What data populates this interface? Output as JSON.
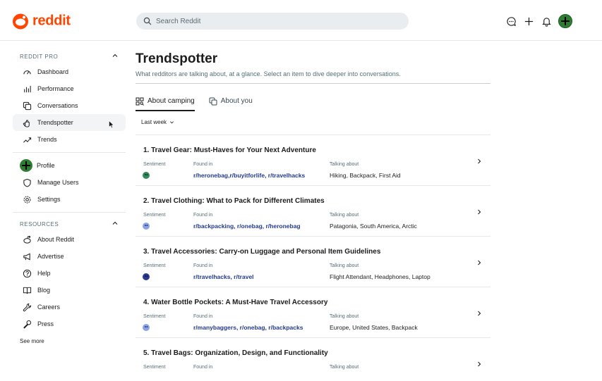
{
  "header": {
    "logo_text": "reddit",
    "search_placeholder": "Search Reddit",
    "icons": [
      "chat-icon",
      "plus-icon",
      "bell-icon",
      "avatar"
    ]
  },
  "sidebar": {
    "pro_section": "REDDIT PRO",
    "pro_items": [
      {
        "label": "Dashboard",
        "icon": "gauge-icon"
      },
      {
        "label": "Performance",
        "icon": "bar-chart-icon"
      },
      {
        "label": "Conversations",
        "icon": "conversations-icon"
      },
      {
        "label": "Trendspotter",
        "icon": "hand-icon"
      },
      {
        "label": "Trends",
        "icon": "trend-icon"
      }
    ],
    "account_items": [
      {
        "label": "Profile",
        "icon": "avatar"
      },
      {
        "label": "Manage Users",
        "icon": "shield-icon"
      },
      {
        "label": "Settings",
        "icon": "gear-icon"
      }
    ],
    "resources_section": "RESOURCES",
    "resource_items": [
      {
        "label": "About Reddit",
        "icon": "reddit-icon"
      },
      {
        "label": "Advertise",
        "icon": "megaphone-icon"
      },
      {
        "label": "Help",
        "icon": "help-icon"
      },
      {
        "label": "Blog",
        "icon": "book-icon"
      },
      {
        "label": "Careers",
        "icon": "wrench-icon"
      },
      {
        "label": "Press",
        "icon": "mic-icon"
      }
    ],
    "see_more": "See more"
  },
  "main": {
    "title": "Trendspotter",
    "subtitle": "What redditors are talking about, at a glance. Select an item to dive deeper into conversations.",
    "tabs": [
      {
        "label": "About camping",
        "active": true
      },
      {
        "label": "About you",
        "active": false
      }
    ],
    "filter": "Last week",
    "col_sentiment": "Sentiment",
    "col_found": "Found in",
    "col_talking": "Talking about",
    "trends": [
      {
        "title": "1. Travel Gear: Must-Haves for Your Next Adventure",
        "sentiment_color": "#2e8b57",
        "found_in": "r/heronebag,r/buyitforlife, r/travelhacks",
        "talking_about": "Hiking, Backpack, First Aid"
      },
      {
        "title": "2. Travel Clothing: What to Pack for Different Climates",
        "sentiment_color": "#8aa3e8",
        "found_in": "r/backpacking, r/onebag, r/heronebag",
        "talking_about": "Patagonia, South America, Arctic"
      },
      {
        "title": "3. Travel Accessories: Carry-on Luggage and Personal Item Guidelines",
        "sentiment_color": "#2b3a8f",
        "found_in": "r/travelhacks, r/travel",
        "talking_about": "Flight Attendant, Headphones, Laptop"
      },
      {
        "title": "4. Water Bottle Pockets: A Must-Have Travel Accessory",
        "sentiment_color": "#8aa3e8",
        "found_in": "r/manybaggers, r/onebag, r/backpacks",
        "talking_about": "Europe, United States, Backpack"
      },
      {
        "title": "5. Travel Bags: Organization, Design, and Functionality",
        "sentiment_color": "",
        "found_in": "",
        "talking_about": ""
      }
    ]
  }
}
